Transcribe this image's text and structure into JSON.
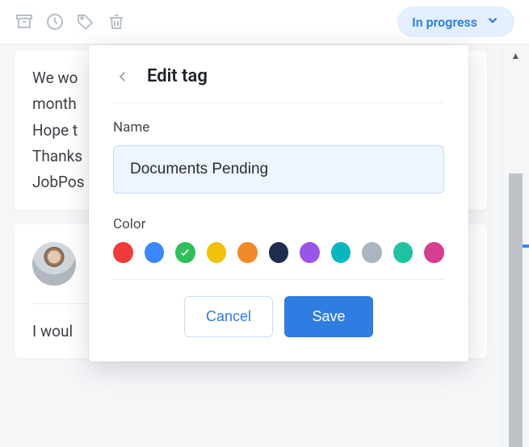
{
  "toolbar": {
    "status_label": "In progress"
  },
  "messages": {
    "first": "We wo\nmonth\nHope t\nThanks\nJobPos",
    "second": "I woul"
  },
  "modal": {
    "title": "Edit tag",
    "name_label": "Name",
    "name_value": "Documents Pending",
    "color_label": "Color",
    "colors": [
      {
        "hex": "#ef3b3b",
        "selected": false
      },
      {
        "hex": "#3a87ff",
        "selected": false
      },
      {
        "hex": "#2fbf5a",
        "selected": true
      },
      {
        "hex": "#f0c20c",
        "selected": false
      },
      {
        "hex": "#f08a2a",
        "selected": false
      },
      {
        "hex": "#1e2d4f",
        "selected": false
      },
      {
        "hex": "#9a55e8",
        "selected": false
      },
      {
        "hex": "#07b6c0",
        "selected": false
      },
      {
        "hex": "#aab4c2",
        "selected": false
      },
      {
        "hex": "#1fc2a0",
        "selected": false
      },
      {
        "hex": "#d63e8f",
        "selected": false
      }
    ],
    "cancel_label": "Cancel",
    "save_label": "Save"
  }
}
